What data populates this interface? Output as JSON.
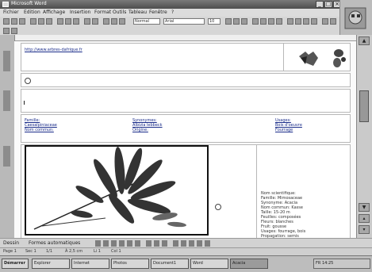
{
  "window": {
    "title": "Microsoft Word",
    "controls": [
      "_",
      "□",
      "×"
    ]
  },
  "menubar": {
    "items": [
      "Fichier",
      "Edition",
      "Affichage",
      "Insertion",
      "Format",
      "Outils",
      "Tableau",
      "Fenêtre",
      "?"
    ]
  },
  "toolbar": {
    "style_value": "Normal",
    "font_value": "Arial",
    "size_value": "10"
  },
  "document": {
    "header_link": "http://www.arbres-dafrique.fr",
    "info_col1": [
      "Famille:",
      "Caesalpiniaceae",
      "Nom commun:"
    ],
    "info_col2": [
      "Synonymes:",
      "Albizia lebbeck",
      "Origine:"
    ],
    "info_col3": [
      "Usages:",
      "Bois d'oeuvre",
      "Fourrage"
    ],
    "caption_lines": [
      "Nom scientifique:",
      "Famille: Mimosaceae",
      "Synonyme: Acacia",
      "Nom commun: Kasse",
      "Taille: 15-20 m",
      "Feuilles: composées",
      "Fleurs: blanches",
      "Fruit: gousse",
      "Usages: fourrage, bois",
      "Propagation: semis"
    ]
  },
  "drawbar": {
    "label": "Dessin",
    "autoshapes": "Formes automatiques"
  },
  "statusbar": {
    "page": "Page 1",
    "section": "Sec 1",
    "of": "1/1",
    "pos": "À 2,5 cm",
    "line": "Li 1",
    "col": "Col 1"
  },
  "taskbar": {
    "start": "Démarrer",
    "tasks": [
      "Explorer",
      "Internet",
      "Photos",
      "Document1",
      "Word",
      "Acacia"
    ],
    "tray": "FR 14:25"
  }
}
